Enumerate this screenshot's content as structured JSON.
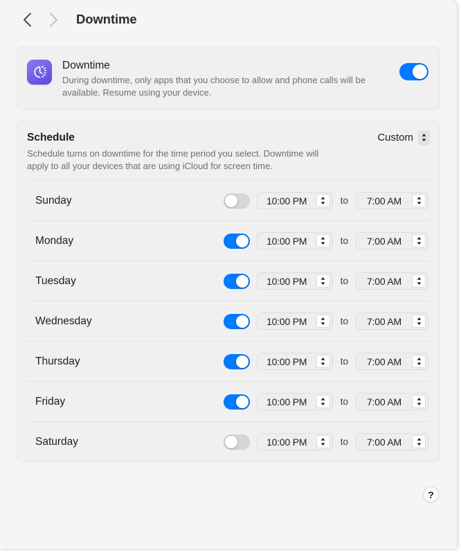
{
  "toolbar": {
    "back_icon": "chevron-left-icon",
    "forward_icon": "chevron-right-icon",
    "title": "Downtime"
  },
  "downtime_card": {
    "icon": "downtime-clock-icon",
    "title": "Downtime",
    "description": "During downtime, only apps that you choose to allow and phone calls will be available. Resume using your device.",
    "toggle_on": true
  },
  "schedule": {
    "title": "Schedule",
    "description": "Schedule turns on downtime for the time period you select. Downtime will apply to all your devices that are using iCloud for screen time.",
    "mode_label": "Custom",
    "mode_icon": "chevron-up-down-icon",
    "to_label": "to",
    "days": [
      {
        "name": "Sunday",
        "enabled": false,
        "start": "10:00 PM",
        "end": "7:00 AM"
      },
      {
        "name": "Monday",
        "enabled": true,
        "start": "10:00 PM",
        "end": "7:00 AM"
      },
      {
        "name": "Tuesday",
        "enabled": true,
        "start": "10:00 PM",
        "end": "7:00 AM"
      },
      {
        "name": "Wednesday",
        "enabled": true,
        "start": "10:00 PM",
        "end": "7:00 AM"
      },
      {
        "name": "Thursday",
        "enabled": true,
        "start": "10:00 PM",
        "end": "7:00 AM"
      },
      {
        "name": "Friday",
        "enabled": true,
        "start": "10:00 PM",
        "end": "7:00 AM"
      },
      {
        "name": "Saturday",
        "enabled": false,
        "start": "10:00 PM",
        "end": "7:00 AM"
      }
    ]
  },
  "help": {
    "label": "?",
    "icon": "question-mark-icon"
  },
  "colors": {
    "accent_on": "#007aff",
    "switch_off": "#d6d6da",
    "icon_purple": "#5a49e0",
    "page_bg": "#f5f5f5",
    "card_bg": "#f0f0f0"
  }
}
